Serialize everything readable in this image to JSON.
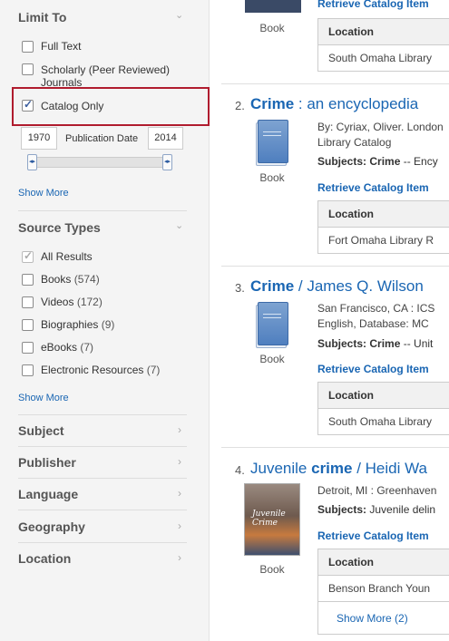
{
  "sidebar": {
    "limit_to": {
      "title": "Limit To",
      "options": [
        {
          "label": "Full Text",
          "checked": false
        },
        {
          "label": "Scholarly (Peer Reviewed) Journals",
          "checked": false
        },
        {
          "label": "Catalog Only",
          "checked": true
        }
      ],
      "date_from": "1970",
      "date_label": "Publication Date",
      "date_to": "2014",
      "show_more": "Show More"
    },
    "source_types": {
      "title": "Source Types",
      "options": [
        {
          "label": "All Results",
          "count": "",
          "checked": true
        },
        {
          "label": "Books",
          "count": "(574)",
          "checked": false
        },
        {
          "label": "Videos",
          "count": "(172)",
          "checked": false
        },
        {
          "label": "Biographies",
          "count": "(9)",
          "checked": false
        },
        {
          "label": "eBooks",
          "count": "(7)",
          "checked": false
        },
        {
          "label": "Electronic Resources",
          "count": "(7)",
          "checked": false
        }
      ],
      "show_more": "Show More"
    },
    "facets": [
      "Subject",
      "Publisher",
      "Language",
      "Geography",
      "Location"
    ]
  },
  "results": [
    {
      "type": "Book",
      "retrieve": "Retrieve Catalog Item",
      "loc_head": "Location",
      "loc_value": "South Omaha Library"
    },
    {
      "num": "2.",
      "title_bold": "Crime",
      "title_rest": " : an encyclopedia",
      "meta1": "By: Cyriax, Oliver. London",
      "meta2": "Library Catalog",
      "subj_label": "Subjects:",
      "subj_bold": "Crime",
      "subj_rest": " -- Ency",
      "type": "Book",
      "retrieve": "Retrieve Catalog Item",
      "loc_head": "Location",
      "loc_value": "Fort Omaha Library R"
    },
    {
      "num": "3.",
      "title_bold": "Crime",
      "title_rest": " / James Q. Wilson",
      "meta1": "San Francisco, CA : ICS",
      "meta2": "English, Database: MC",
      "subj_label": "Subjects:",
      "subj_bold": "Crime",
      "subj_rest": " -- Unit",
      "type": "Book",
      "retrieve": "Retrieve Catalog Item",
      "loc_head": "Location",
      "loc_value": "South Omaha Library"
    },
    {
      "num": "4.",
      "title_pre": "Juvenile ",
      "title_bold": "crime",
      "title_rest": " / Heidi Wa",
      "meta1": "Detroit, MI : Greenhaven",
      "subj_label": "Subjects:",
      "subj_rest": " Juvenile delin",
      "type": "Book",
      "retrieve": "Retrieve Catalog Item",
      "loc_head": "Location",
      "loc_value": "Benson Branch Youn",
      "show_more": "Show More (2)",
      "thumb_text": "Juvenile Crime"
    }
  ],
  "colors": {
    "link": "#1a66b3",
    "highlight": "#b01c2e",
    "sidebar_bg": "#f4f4f4"
  }
}
